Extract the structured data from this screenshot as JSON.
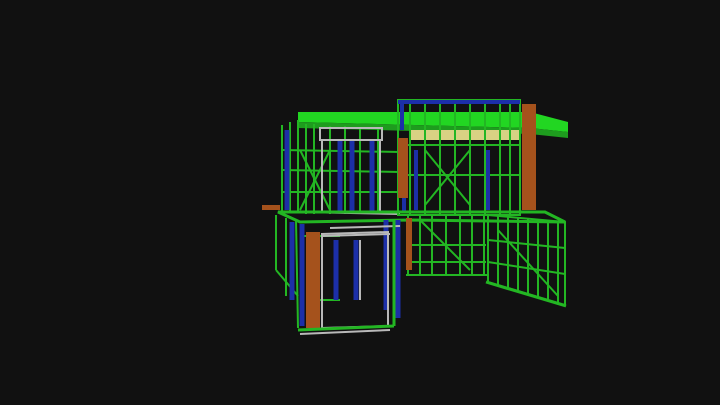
{
  "viewer": {
    "background": "#111111",
    "colors": {
      "green": "#23b623",
      "bright_green": "#22d622",
      "blue": "#1c2fa8",
      "gray": "#b9b9b9",
      "orange": "#a5521c",
      "yellow": "#d8d283"
    }
  }
}
